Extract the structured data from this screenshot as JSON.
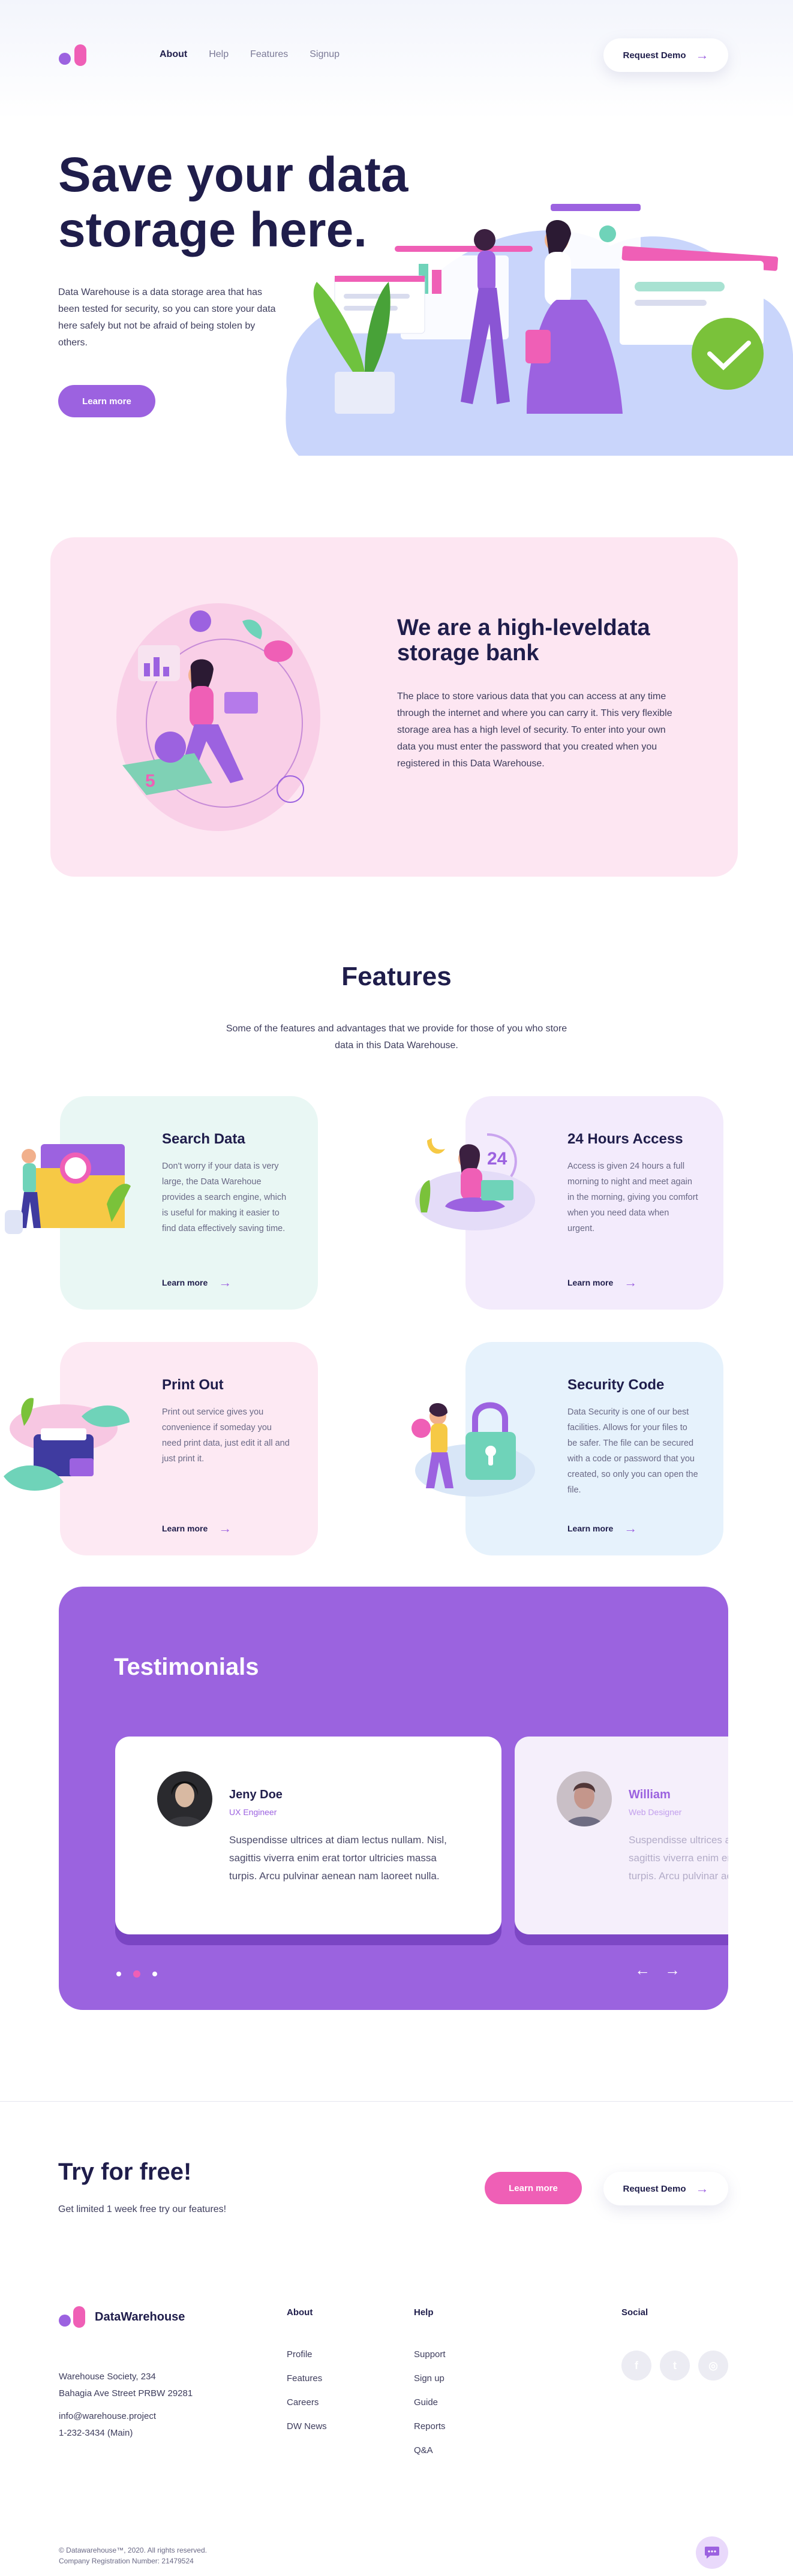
{
  "nav": {
    "links": [
      "About",
      "Help",
      "Features",
      "Signup"
    ],
    "active": "About",
    "demo_label": "Request Demo"
  },
  "hero": {
    "title": "Save your data storage here.",
    "text": "Data Warehouse is a data storage area that has been tested for security, so you can store your data here safely but not be afraid of being stolen by others.",
    "button": "Learn more"
  },
  "about": {
    "title": "We are a high-leveldata storage bank",
    "text": "The place to store various data that you can access at any time through the internet and where you can carry it. This very flexible storage area has a high level of security. To enter into your own data you must enter the password that you created when you registered in this Data Warehouse."
  },
  "features": {
    "title": "Features",
    "subtitle": "Some of the features and advantages that we provide for those of you who store data in this Data Warehouse.",
    "more_label": "Learn more",
    "items": [
      {
        "title": "Search Data",
        "text": "Don't worry if your data is very large, the Data Warehoue provides a search engine, which is useful for making it easier to find data effectively saving time."
      },
      {
        "title": "24 Hours Access",
        "text": "Access is given 24 hours a full morning to night and meet again in the morning, giving you comfort when you need data when urgent."
      },
      {
        "title": "Print Out",
        "text": "Print out service gives you convenience if someday you need print data, just edit it all and just print it."
      },
      {
        "title": "Security Code",
        "text": "Data Security is one of our best facilities. Allows for your files to be safer. The file can be secured with a code or password that you created, so only you can open the file."
      }
    ],
    "colors": [
      "#e9f7f4",
      "#f3ebfc",
      "#fde9f3",
      "#e6f2fc"
    ]
  },
  "testimonials": {
    "title": "Testimonials",
    "items": [
      {
        "name": "Jeny Doe",
        "role": "UX Engineer",
        "quote": "Suspendisse ultrices at diam lectus nullam. Nisl, sagittis viverra enim erat tortor ultricies massa turpis. Arcu pulvinar aenean nam laoreet nulla."
      },
      {
        "name": "William",
        "role": "Web Designer",
        "quote": "Suspendisse ultrices at diam lectus nullam. Nisl, sagittis viverra enim erat tortor ultricies massa turpis. Arcu pulvinar aenean nam laoreet nulla."
      }
    ],
    "arrows": [
      "←",
      "→"
    ]
  },
  "cta": {
    "title": "Try for free!",
    "subtitle": "Get limited 1 week free try our features!",
    "try_label": "Learn more",
    "demo_label": "Request Demo"
  },
  "footer": {
    "brand": "DataWarehouse",
    "address": [
      "Warehouse Society, 234",
      "Bahagia Ave Street PRBW 29281"
    ],
    "contact": [
      "info@warehouse.project",
      "1-232-3434 (Main)"
    ],
    "columns": [
      {
        "title": "About",
        "links": [
          "Profile",
          "Features",
          "Careers",
          "DW News"
        ]
      },
      {
        "title": "Help",
        "links": [
          "Support",
          "Sign up",
          "Guide",
          "Reports",
          "Q&A"
        ]
      },
      {
        "title": "Social",
        "links": []
      }
    ],
    "social_icons": [
      "facebook-icon",
      "twitter-icon",
      "instagram-icon"
    ],
    "copyright": "© Datawarehouse™, 2020. All rights reserved.",
    "company_reg": "Company Registration Number: 21479524"
  }
}
